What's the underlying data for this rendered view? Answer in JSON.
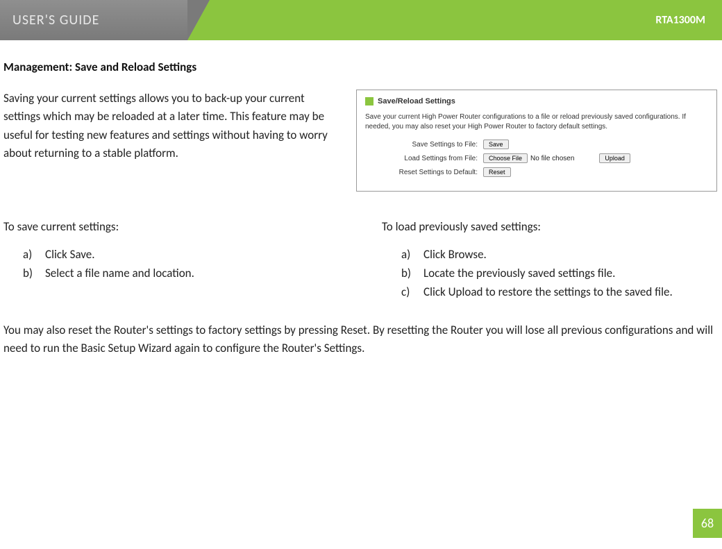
{
  "header": {
    "title": "USER'S GUIDE",
    "model": "RTA1300M"
  },
  "section_title": "Management: Save and Reload Settings",
  "intro": "Saving your current settings allows you to back-up your current settings which may be reloaded at a later time.  This feature may be useful for testing new features and settings without having to worry about returning to a stable platform.",
  "screenshot": {
    "title": "Save/Reload Settings",
    "desc": "Save your current High Power Router configurations to a file or reload previously saved configurations. If needed, you may also reset your High Power Router to factory default settings.",
    "rows": {
      "save_label": "Save Settings to File:",
      "save_btn": "Save",
      "load_label": "Load Settings from File:",
      "choose_btn": "Choose File",
      "no_file": "No file chosen",
      "upload_btn": "Upload",
      "reset_label": "Reset Settings to Default:",
      "reset_btn": "Reset"
    }
  },
  "col_left": {
    "heading": "To save current settings:",
    "items": [
      {
        "m": "a)",
        "t": "Click Save."
      },
      {
        "m": "b)",
        "t": "Select a file name and location."
      }
    ]
  },
  "col_right": {
    "heading": "To load previously saved settings:",
    "items": [
      {
        "m": "a)",
        "t": "Click Browse."
      },
      {
        "m": "b)",
        "t": "Locate the previously saved settings file."
      },
      {
        "m": "c)",
        "t": "Click Upload to restore the settings to the saved file."
      }
    ]
  },
  "footer_text": "You may also reset the Router's settings to factory settings by pressing Reset.  By resetting the Router you will lose all previous configurations and will need to run the Basic Setup Wizard again to configure the Router's Settings.",
  "page_number": "68"
}
